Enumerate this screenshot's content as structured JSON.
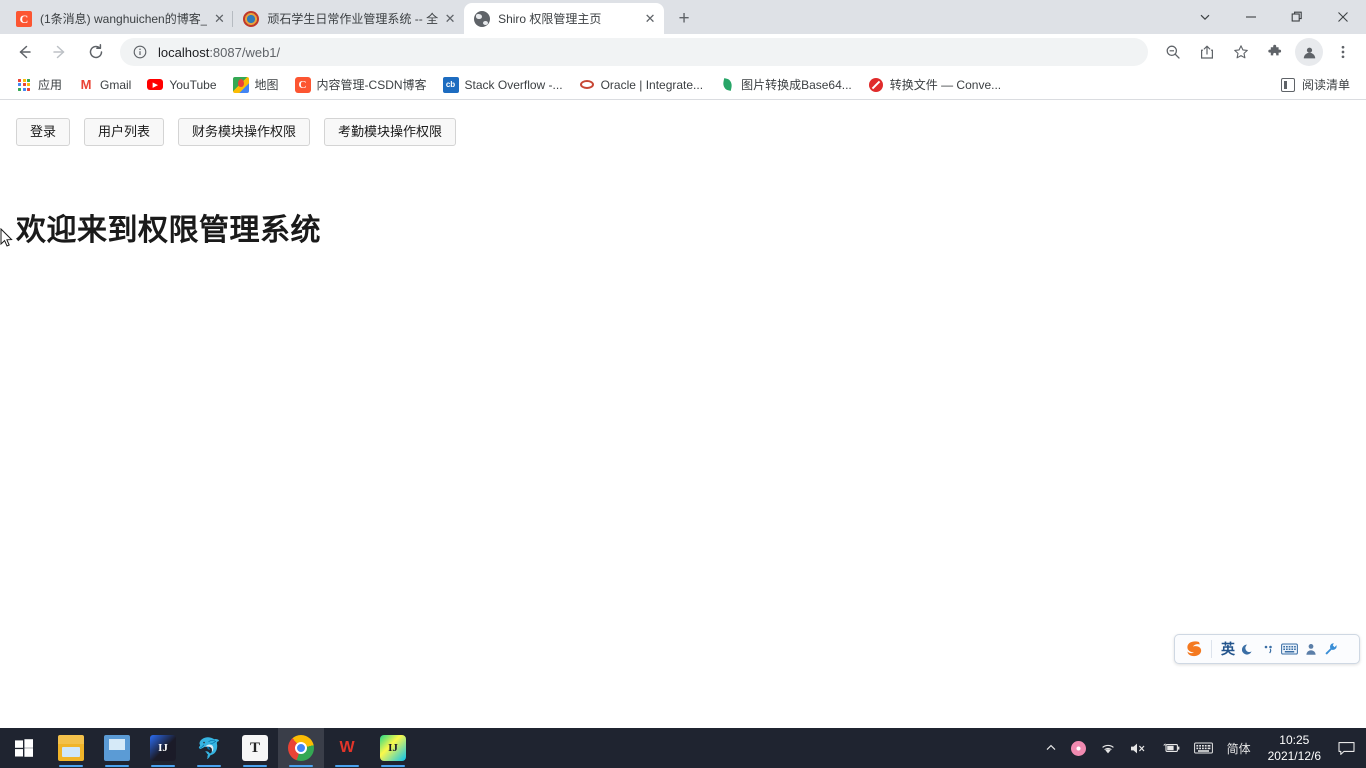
{
  "window": {
    "controls": [
      {
        "name": "tab-search",
        "glyph": "chevron-down"
      },
      {
        "name": "minimize",
        "glyph": "minimize"
      },
      {
        "name": "maximize",
        "glyph": "restore"
      },
      {
        "name": "close",
        "glyph": "close"
      }
    ]
  },
  "tabs": [
    {
      "title": "(1条消息) wanghuichen的博客_",
      "favicon": "csdn-icon",
      "active": false
    },
    {
      "title": "顽石学生日常作业管理系统 -- 全",
      "favicon": "ring-icon",
      "active": false
    },
    {
      "title": "Shiro 权限管理主页",
      "favicon": "globe-icon",
      "active": true
    }
  ],
  "new_tab_label": "+",
  "toolbar": {
    "back": "←",
    "forward": "→",
    "reload": "⟳",
    "url": "localhost:8087/web1/",
    "url_host": "localhost",
    "url_rest": ":8087/web1/",
    "site_info_icon": "info-circle-icon",
    "right_icons": [
      {
        "name": "zoom-out-icon",
        "label": "zoom"
      },
      {
        "name": "share-icon",
        "label": "share"
      },
      {
        "name": "bookmark-star-icon",
        "label": "bookmark"
      },
      {
        "name": "extensions-puzzle-icon",
        "label": "extensions"
      },
      {
        "name": "profile-avatar-icon",
        "label": "profile"
      },
      {
        "name": "chrome-menu-icon",
        "label": "menu"
      }
    ]
  },
  "bookmarks": [
    {
      "label": "应用",
      "icon": "apps-grid-icon"
    },
    {
      "label": "Gmail",
      "icon": "gmail-icon"
    },
    {
      "label": "YouTube",
      "icon": "youtube-icon"
    },
    {
      "label": "地图",
      "icon": "google-maps-icon"
    },
    {
      "label": "内容管理-CSDN博客",
      "icon": "csdn-icon"
    },
    {
      "label": "Stack Overflow -...",
      "icon": "stackoverflow-icon"
    },
    {
      "label": "Oracle | Integrate...",
      "icon": "oracle-icon"
    },
    {
      "label": "图片转换成Base64...",
      "icon": "leaf-icon"
    },
    {
      "label": "转换文件 — Conve...",
      "icon": "convert-icon"
    }
  ],
  "reading_list": {
    "label": "阅读清单",
    "icon": "reading-list-icon"
  },
  "page": {
    "buttons": [
      {
        "label": "登录",
        "name": "login-button"
      },
      {
        "label": "用户列表",
        "name": "user-list-button"
      },
      {
        "label": "财务模块操作权限",
        "name": "finance-module-permission-button"
      },
      {
        "label": "考勤模块操作权限",
        "name": "attendance-module-permission-button"
      }
    ],
    "heading": "欢迎来到权限管理系统"
  },
  "ime": {
    "logo": "sogou-logo-icon",
    "mode_label": "英",
    "items": [
      {
        "name": "moon-icon",
        "glyph": "☾"
      },
      {
        "name": "punctuation-icon",
        "glyph": "⁏"
      },
      {
        "name": "soft-keyboard-icon",
        "glyph": "⌨"
      },
      {
        "name": "user-icon",
        "glyph": "♟"
      },
      {
        "name": "toolbox-wrench-icon",
        "glyph": "🔧"
      }
    ]
  },
  "taskbar": {
    "start": {
      "name": "windows-start-icon"
    },
    "apps": [
      {
        "name": "file-explorer-icon",
        "label": "File Explorer",
        "running": true,
        "active": false
      },
      {
        "name": "display-monitor-icon",
        "label": "Monitor",
        "running": true,
        "active": false
      },
      {
        "name": "intellij-idea-icon",
        "label": "IntelliJ IDEA",
        "running": true,
        "active": false
      },
      {
        "name": "navicat-icon",
        "label": "Navicat",
        "running": true,
        "active": false
      },
      {
        "name": "typora-icon",
        "label": "Typora",
        "running": true,
        "active": false
      },
      {
        "name": "chrome-icon",
        "label": "Google Chrome",
        "running": true,
        "active": true
      },
      {
        "name": "wps-office-icon",
        "label": "WPS Office",
        "running": true,
        "active": false
      },
      {
        "name": "pycharm-icon",
        "label": "PyCharm",
        "running": true,
        "active": false
      }
    ],
    "tray": {
      "overflow": "⌃",
      "sogou": "sogou-flower-icon",
      "wifi": "wifi-icon",
      "volume": "volume-muted-icon",
      "battery": "battery-icon",
      "keyboard": "keyboard-icon",
      "ime_label": "简体",
      "time": "10:25",
      "date": "2021/12/6",
      "notifications": "notification-icon"
    }
  },
  "colors": {
    "chrome_bg": "#dee1e6",
    "toolbar_bg": "#ffffff",
    "page_bg": "#ffffff",
    "taskbar_bg": "#1f2430",
    "accent_blue": "#4aa3f0"
  }
}
